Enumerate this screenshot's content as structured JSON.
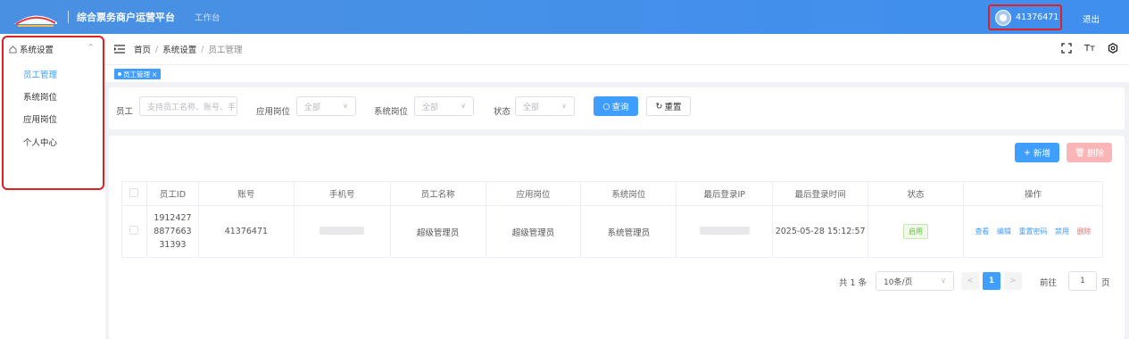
{
  "header": {
    "title": "综合票务商户运营平台",
    "workbench": "工作台",
    "user": "41376471",
    "logout": "退出"
  },
  "sidebar": {
    "group": "系统设置",
    "items": [
      {
        "label": "员工管理",
        "active": true
      },
      {
        "label": "系统岗位",
        "active": false
      },
      {
        "label": "应用岗位",
        "active": false
      },
      {
        "label": "个人中心",
        "active": false
      }
    ]
  },
  "breadcrumb": [
    "首页",
    "系统设置",
    "员工管理"
  ],
  "tabs": [
    {
      "label": "员工管理"
    }
  ],
  "filters": {
    "employee": {
      "label": "员工",
      "placeholder": "支持员工名称、账号、手"
    },
    "app_post": {
      "label": "应用岗位",
      "value": "全部"
    },
    "sys_post": {
      "label": "系统岗位",
      "value": "全部"
    },
    "status": {
      "label": "状态",
      "value": "全部"
    },
    "query_label": "查询",
    "reset_label": "重置"
  },
  "actions": {
    "add_label": "新增",
    "delete_label": "删除"
  },
  "table": {
    "columns": [
      "员工ID",
      "账号",
      "手机号",
      "员工名称",
      "应用岗位",
      "系统岗位",
      "最后登录IP",
      "最后登录时间",
      "状态",
      "操作"
    ],
    "rows": [
      {
        "id_lines": [
          "1912427",
          "8877663",
          "31393"
        ],
        "account": "41376471",
        "name": "超级管理员",
        "app_post": "超级管理员",
        "sys_post": "系统管理员",
        "last_login_time": "2025-05-28 15:12:57",
        "status": "启用",
        "ops": [
          "查看",
          "编辑",
          "重置密码",
          "禁用",
          "删除"
        ]
      }
    ]
  },
  "pagination": {
    "total": "共 1 条",
    "page_size": "10条/页",
    "current_page": "1",
    "goto_label": "前往",
    "goto_value": "1",
    "page_suffix": "页"
  },
  "colors": {
    "primary": "#409eff",
    "header": "#4a90e2",
    "danger": "#f56c6c",
    "highlight": "#e02020"
  }
}
